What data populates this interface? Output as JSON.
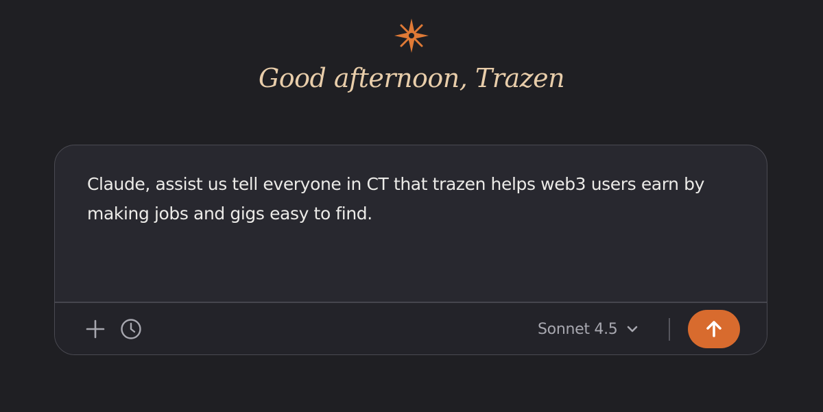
{
  "header": {
    "greeting": "Good afternoon, Trazen",
    "logo_icon": "starburst-icon",
    "logo_color": "#e07a36"
  },
  "composer": {
    "prompt_text": "Claude, assist us tell everyone in CT that trazen helps web3 users earn by making jobs and gigs easy to find.",
    "toolbar": {
      "add_icon": "plus-icon",
      "history_icon": "clock-icon",
      "model_label": "Sonnet 4.5",
      "model_dropdown_icon": "chevron-down-icon",
      "send_icon": "arrow-up-icon",
      "send_color": "#d86b2e"
    }
  }
}
